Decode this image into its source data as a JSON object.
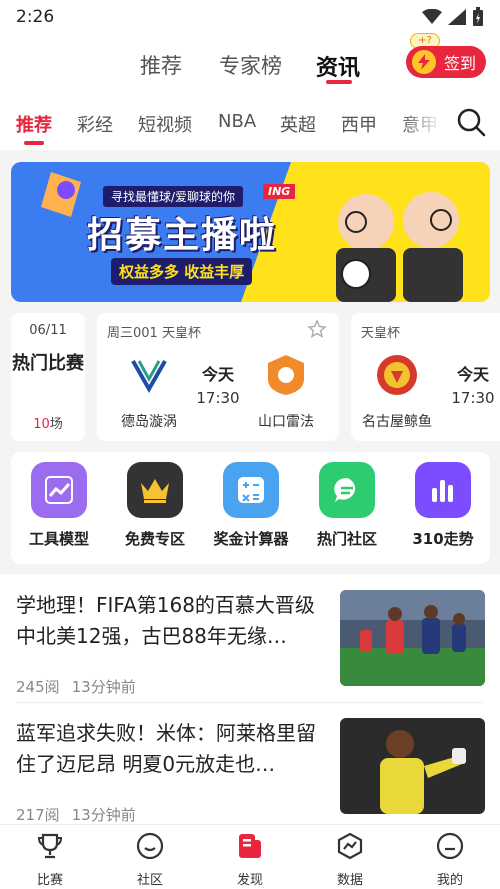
{
  "status_bar": {
    "time": "2:26"
  },
  "top_tabs": [
    {
      "label": "推荐"
    },
    {
      "label": "专家榜"
    },
    {
      "label": "资讯"
    }
  ],
  "sign_in": {
    "label": "签到",
    "badge": "+?"
  },
  "category_tabs": [
    "推荐",
    "彩经",
    "短视频",
    "NBA",
    "英超",
    "西甲",
    "意甲"
  ],
  "banner": {
    "top_text": "寻找最懂球/爱聊球的你",
    "tag": "ING",
    "title": "招募主播啦",
    "subtitle": "权益多多 收益丰厚"
  },
  "matches_summary": {
    "date": "06/11",
    "title": "热门比赛",
    "count": "10",
    "count_unit": "场"
  },
  "matches": [
    {
      "league": "周三001 天皇杯",
      "home": "德岛漩涡",
      "away": "山口雷法",
      "day": "今天",
      "time": "17:30"
    },
    {
      "league": "天皇杯",
      "home": "名古屋鲸鱼",
      "day": "今天",
      "time": "17:30"
    }
  ],
  "tools": [
    {
      "label": "工具模型",
      "color": "#8b5cf6"
    },
    {
      "label": "免费专区",
      "color": "#333333"
    },
    {
      "label": "奖金计算器",
      "color": "#4aa3f0"
    },
    {
      "label": "热门社区",
      "color": "#2ecc71"
    },
    {
      "label": "310走势",
      "color": "#7c4dff"
    }
  ],
  "news": [
    {
      "title": "学地理！FIFA第168的百慕大晋级中北美12强，古巴88年无缘…",
      "reads": "245阅",
      "time": "13分钟前"
    },
    {
      "title": "蓝军追求失败！米体：阿莱格里留住了迈尼昂 明夏0元放走也…",
      "reads": "217阅",
      "time": "13分钟前"
    }
  ],
  "bottom_nav": [
    {
      "label": "比赛"
    },
    {
      "label": "社区"
    },
    {
      "label": "发现",
      "active": true
    },
    {
      "label": "数据"
    },
    {
      "label": "我的"
    }
  ],
  "colors": {
    "accent": "#e8273f"
  }
}
